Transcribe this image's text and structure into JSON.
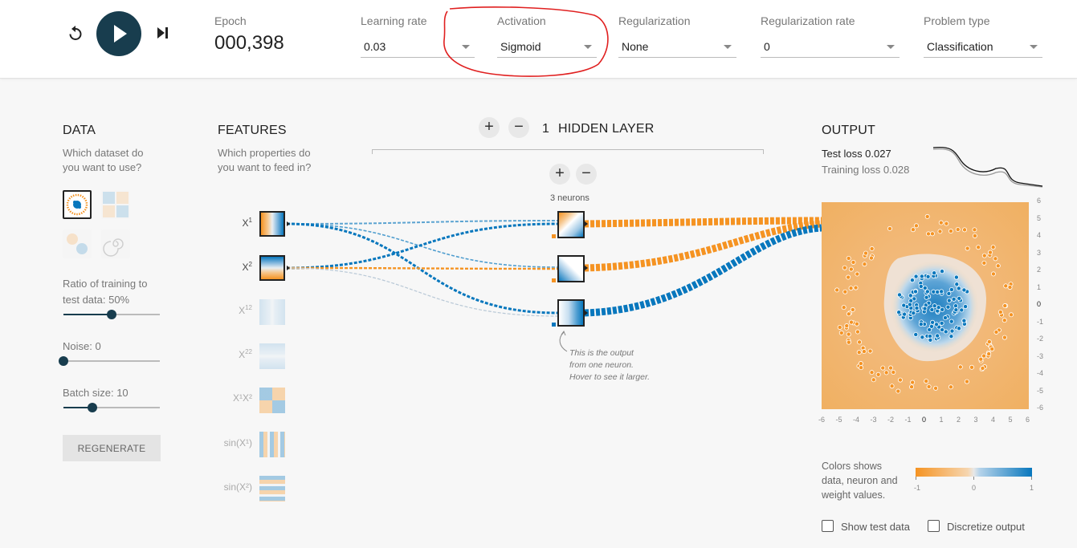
{
  "topbar": {
    "epoch_label": "Epoch",
    "epoch_value": "000,398",
    "learning_rate": {
      "label": "Learning rate",
      "value": "0.03"
    },
    "activation": {
      "label": "Activation",
      "value": "Sigmoid"
    },
    "regularization": {
      "label": "Regularization",
      "value": "None"
    },
    "regularization_rate": {
      "label": "Regularization rate",
      "value": "0"
    },
    "problem_type": {
      "label": "Problem type",
      "value": "Classification"
    }
  },
  "data_panel": {
    "title": "DATA",
    "subtitle_line1": "Which dataset do",
    "subtitle_line2": "you want to use?",
    "ratio_label": "Ratio of training to",
    "ratio_label2": "test data:  50%",
    "ratio_value": 0.5,
    "noise_label": "Noise:  0",
    "noise_value": 0,
    "batch_label": "Batch size:  10",
    "batch_value": 0.3,
    "regenerate": "REGENERATE"
  },
  "features_panel": {
    "title": "FEATURES",
    "subtitle_line1": "Which properties do",
    "subtitle_line2": "you want to feed in?",
    "features": [
      {
        "label": "X",
        "sup": "1",
        "active": true
      },
      {
        "label": "X",
        "sup": "2",
        "active": true
      },
      {
        "label": "X",
        "sup": "12",
        "active": false
      },
      {
        "label": "X",
        "sup": "22",
        "active": false
      },
      {
        "label": "X¹X²",
        "sup": "",
        "active": false
      },
      {
        "label": "sin(X¹)",
        "sup": "",
        "active": false
      },
      {
        "label": "sin(X²)",
        "sup": "",
        "active": false
      }
    ]
  },
  "network": {
    "layers_count": "1",
    "layers_label": "HIDDEN LAYER",
    "neurons_label": "3 neurons",
    "note": "This is the output from one neuron. Hover to see it larger."
  },
  "output_panel": {
    "title": "OUTPUT",
    "test_loss": "Test loss 0.027",
    "training_loss": "Training loss 0.028",
    "colors_text_1": "Colors shows",
    "colors_text_2": "data, neuron and",
    "colors_text_3": "weight values.",
    "scale_min": "-1",
    "scale_mid": "0",
    "scale_max": "1",
    "show_test": "Show test data",
    "discretize": "Discretize output",
    "ticks": [
      "-6",
      "-5",
      "-4",
      "-3",
      "-2",
      "-1",
      "0",
      "1",
      "2",
      "3",
      "4",
      "5",
      "6"
    ],
    "y_ticks": [
      "6",
      "5",
      "4",
      "3",
      "2",
      "1",
      "0",
      "-1",
      "-2",
      "-3",
      "-4",
      "-5",
      "-6"
    ]
  },
  "colors": {
    "orange": "#f59322",
    "blue": "#0877bd",
    "dark": "#183d4e",
    "annotation_red": "#e02020"
  }
}
